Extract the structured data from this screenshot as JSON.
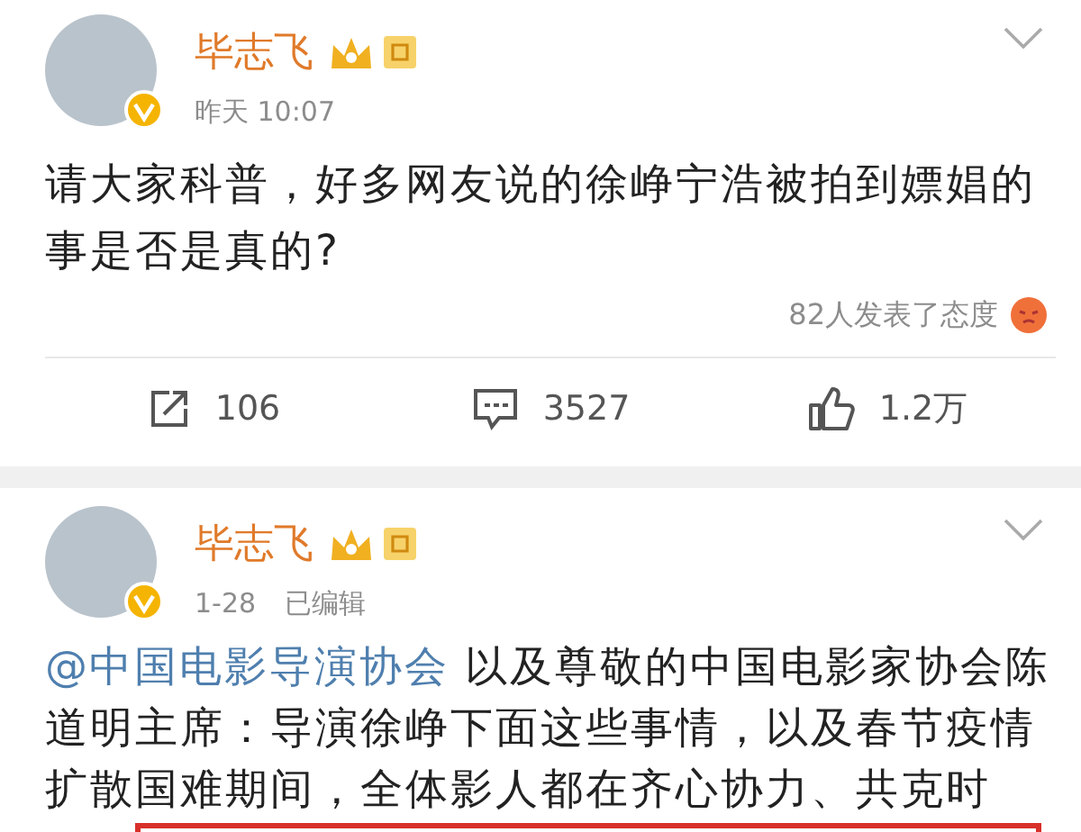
{
  "posts": [
    {
      "author": "毕志飞",
      "time": "昨天 10:07",
      "text": "请大家科普，好多网友说的徐峥宁浩被拍到嫖娼的事是否是真的?",
      "reactions": "82人发表了态度",
      "actions": [
        {
          "kind": "repost",
          "count": "106"
        },
        {
          "kind": "comment",
          "count": "3527"
        },
        {
          "kind": "like",
          "count": "1.2万"
        }
      ],
      "annotated": false
    },
    {
      "author": "毕志飞",
      "time": "1-28",
      "edited": "已编辑",
      "mention": "@中国电影导演协会",
      "text": "以及尊敬的中国电影家协会陈道明主席：导演徐峥下面这些事情，以及春节疫情扩散国难期间，全体影人都在齐心协力、共克时",
      "annotated": true
    }
  ]
}
